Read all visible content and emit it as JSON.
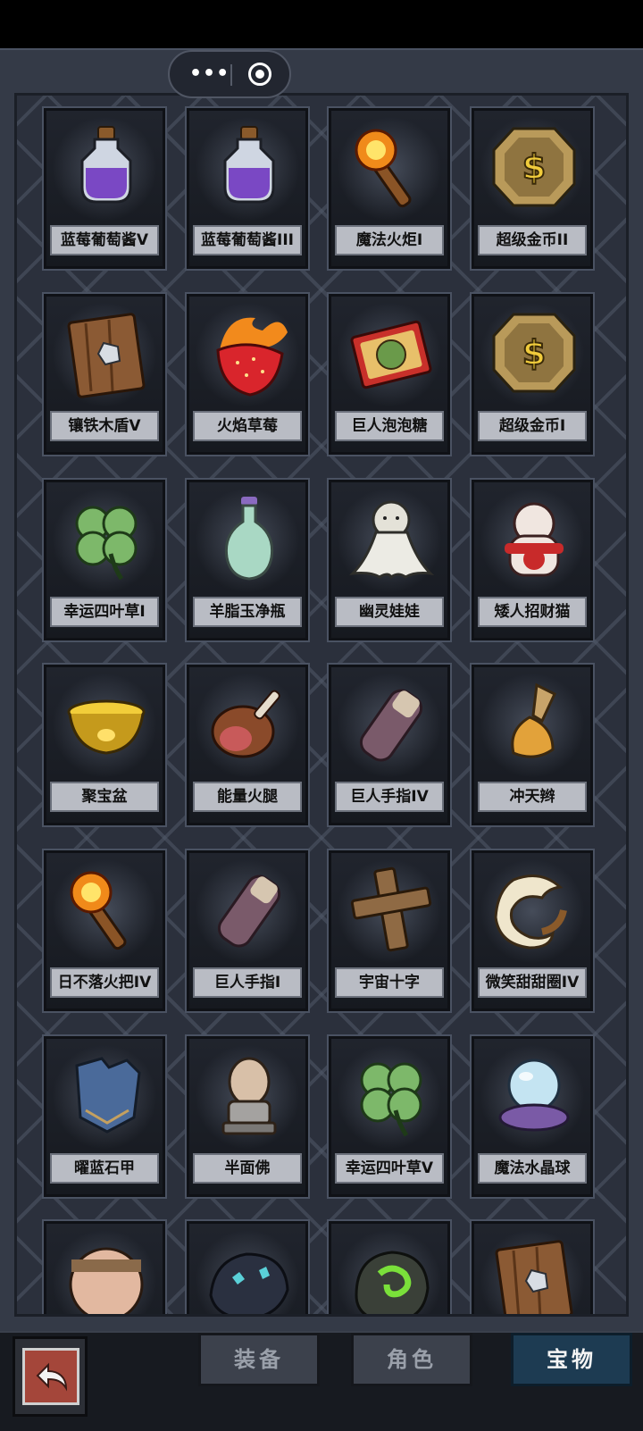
{
  "items": [
    {
      "name": "蓝莓葡萄酱V",
      "icon": "potion-icon"
    },
    {
      "name": "蓝莓葡萄酱III",
      "icon": "potion-icon"
    },
    {
      "name": "魔法火炬I",
      "icon": "torch-icon"
    },
    {
      "name": "超级金币II",
      "icon": "gold-coin-icon"
    },
    {
      "name": "镶铁木盾V",
      "icon": "wooden-shield-icon"
    },
    {
      "name": "火焰草莓",
      "icon": "fire-strawberry-icon"
    },
    {
      "name": "巨人泡泡糖",
      "icon": "bubblegum-box-icon"
    },
    {
      "name": "超级金币I",
      "icon": "gold-coin-icon"
    },
    {
      "name": "幸运四叶草I",
      "icon": "four-leaf-clover-icon"
    },
    {
      "name": "羊脂玉净瓶",
      "icon": "jade-vase-icon"
    },
    {
      "name": "幽灵娃娃",
      "icon": "ghost-doll-icon"
    },
    {
      "name": "矮人招财猫",
      "icon": "lucky-cat-icon"
    },
    {
      "name": "聚宝盆",
      "icon": "treasure-bowl-icon"
    },
    {
      "name": "能量火腿",
      "icon": "ham-icon"
    },
    {
      "name": "巨人手指IV",
      "icon": "giant-finger-icon"
    },
    {
      "name": "冲天辫",
      "icon": "pigtail-icon"
    },
    {
      "name": "日不落火把IV",
      "icon": "torch-icon"
    },
    {
      "name": "巨人手指I",
      "icon": "giant-finger-icon"
    },
    {
      "name": "宇宙十字",
      "icon": "wooden-cross-icon"
    },
    {
      "name": "微笑甜甜圈IV",
      "icon": "donut-icon"
    },
    {
      "name": "曜蓝石甲",
      "icon": "stone-armor-icon"
    },
    {
      "name": "半面佛",
      "icon": "buddha-bust-icon"
    },
    {
      "name": "幸运四叶草V",
      "icon": "four-leaf-clover-icon"
    },
    {
      "name": "魔法水晶球",
      "icon": "crystal-ball-icon"
    },
    {
      "name": "",
      "icon": "bandaged-head-icon"
    },
    {
      "name": "",
      "icon": "crystal-ore-icon"
    },
    {
      "name": "",
      "icon": "green-rune-stone-icon"
    },
    {
      "name": "",
      "icon": "wooden-shield-icon"
    }
  ],
  "tabs": [
    {
      "label": "装备",
      "active": false
    },
    {
      "label": "角色",
      "active": false
    },
    {
      "label": "宝物",
      "active": true
    }
  ],
  "capsule": {
    "more_icon": "more-dots-icon",
    "close_icon": "target-icon"
  },
  "back_icon": "back-arrow-icon"
}
